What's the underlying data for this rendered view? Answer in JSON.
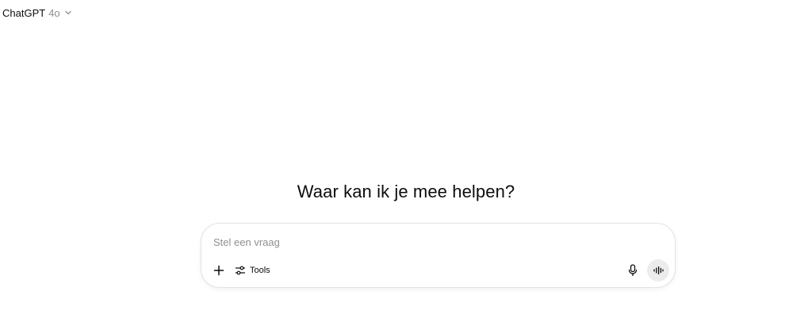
{
  "header": {
    "model_name": "ChatGPT",
    "model_version": "4o",
    "chevron_icon": "chevron-down-icon"
  },
  "main": {
    "headline": "Waar kan ik je mee helpen?"
  },
  "composer": {
    "placeholder": "Stel een vraag",
    "value": "",
    "plus_icon": "plus-icon",
    "tools_icon": "sliders-icon",
    "tools_label": "Tools",
    "mic_icon": "microphone-icon",
    "voice_icon": "voice-mode-icon"
  },
  "colors": {
    "text": "#0d0d0d",
    "muted": "#8f8f8f",
    "border": "#e3e3e3",
    "voice_button_bg": "#ececec"
  }
}
